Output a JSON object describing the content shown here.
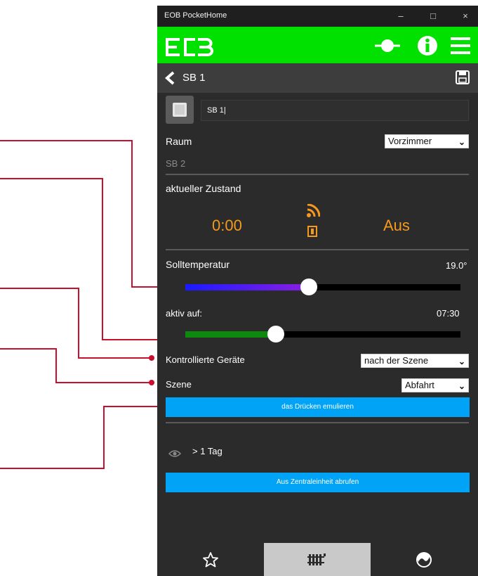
{
  "window": {
    "title": "EOB PocketHome",
    "minimize": "–",
    "maximize": "□",
    "close": "×"
  },
  "nav": {
    "title": "SB 1"
  },
  "device": {
    "name_value": "SB 1|"
  },
  "room": {
    "label": "Raum",
    "selected": "Vorzimmer",
    "subtitle": "SB 2"
  },
  "state": {
    "label": "aktueller Zustand",
    "time": "0:00",
    "status": "Aus"
  },
  "target_temp": {
    "label": "Solltemperatur",
    "value": "19.0°",
    "slider_fraction": 0.45
  },
  "active_on": {
    "label": "aktiv auf:",
    "value": "07:30",
    "slider_fraction": 0.33
  },
  "controlled_devices": {
    "label": "Kontrollierte Geräte",
    "selected": "nach der Szene"
  },
  "scene": {
    "label": "Szene",
    "selected": "Abfahrt"
  },
  "actions": {
    "simulate_label": "das Drücken emulieren",
    "fetch_label": "Aus Zentraleinheit abrufen"
  },
  "visibility": {
    "text": "> 1 Tag"
  },
  "colors": {
    "accent_green": "#00e100",
    "accent_blue": "#00a3f5",
    "accent_orange": "#f59a1d",
    "callout_red": "#c8102e"
  },
  "icons": {
    "back": "chevron-left-icon",
    "save": "floppy-disk-icon",
    "connect": "connector-icon",
    "info": "info-icon",
    "menu": "hamburger-menu-icon",
    "favorites": "star-icon",
    "radiator": "radiator-icon",
    "weather": "globe-icon"
  }
}
